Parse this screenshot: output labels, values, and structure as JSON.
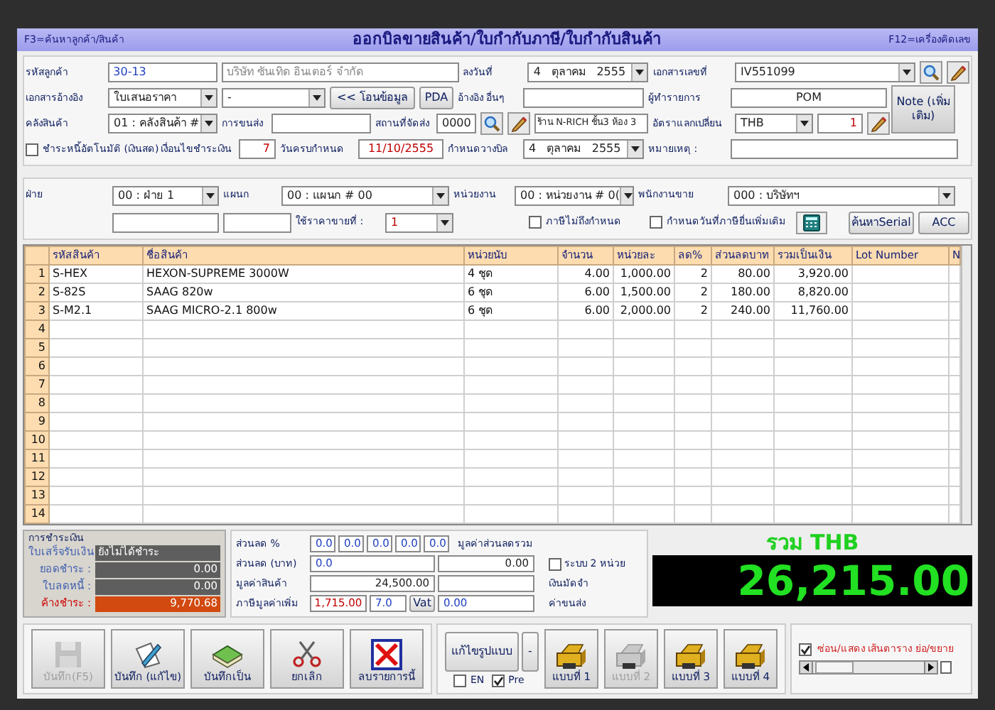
{
  "title_bar": {
    "hotkey_left": "F3=ค้นหาลูกค้า/สินค้า",
    "title": "ออกบิลขายสินค้า/ใบกำกับภาษี/ใบกำกับสินค้า",
    "hotkey_right": "F12=เครื่องคิดเลข"
  },
  "header_rows": [
    [
      {
        "kind": "label",
        "text": "รหัสลูกค้า"
      },
      {
        "kind": "field",
        "value": "30-13"
      },
      {
        "kind": "field",
        "value": "บริษัท ซันเทิด อินเตอร์ จำกัด"
      },
      {
        "kind": "label",
        "text": "ลงวันที่"
      },
      {
        "kind": "select",
        "value": "4   ตุลาคม   2555"
      },
      {
        "kind": "label",
        "text": "เอกสารเลขที่"
      },
      {
        "kind": "select",
        "value": "IV551099"
      },
      {
        "kind": "search"
      },
      {
        "kind": "edit"
      }
    ],
    [
      {
        "kind": "label",
        "text": "เอกสารอ้างอิง"
      },
      {
        "kind": "select",
        "value": "ใบเสนอราคา"
      },
      {
        "kind": "select",
        "value": "-"
      },
      {
        "kind": "button",
        "text": "<< โอนข้อมูล"
      },
      {
        "kind": "button",
        "text": "PDA"
      },
      {
        "kind": "label",
        "text": "อ้างอิง อื่นๆ"
      },
      {
        "kind": "field"
      },
      {
        "kind": "label",
        "text": "ผู้ทำรายการ"
      },
      {
        "kind": "field",
        "value": "POM"
      },
      {
        "kind": "note",
        "text": "Note (เพิ่มเติม)"
      }
    ],
    [
      {
        "kind": "label",
        "text": "คลังสินค้า"
      },
      {
        "kind": "select",
        "value": "01 : คลังสินค้า #"
      },
      {
        "kind": "label",
        "text": "การขนส่ง"
      },
      {
        "kind": "field"
      },
      {
        "kind": "label",
        "text": "สถานที่จัดส่ง"
      },
      {
        "kind": "field",
        "value": "0000"
      },
      {
        "kind": "search"
      },
      {
        "kind": "edit"
      },
      {
        "kind": "field",
        "value": "ร้าน N-RICH ชั้น3 ห้อง 3"
      },
      {
        "kind": "label",
        "text": "อัตราแลกเปลี่ยน"
      },
      {
        "kind": "select",
        "value": "THB"
      },
      {
        "kind": "field",
        "value": "1"
      },
      {
        "kind": "edit"
      }
    ],
    [
      {
        "kind": "checkbox",
        "text": "ชำระหนี้อัตโนมัติ (เงินสด)",
        "checked": false
      },
      {
        "kind": "label",
        "text": "เงื่อนไขชำระเงิน"
      },
      {
        "kind": "field",
        "value": "7"
      },
      {
        "kind": "label",
        "text": "วันครบกำหนด"
      },
      {
        "kind": "field",
        "value": "11/10/2555"
      },
      {
        "kind": "label",
        "text": "กำหนดวางบิล"
      },
      {
        "kind": "select",
        "value": "4   ตุลาคม   2555"
      },
      {
        "kind": "label",
        "text": "หมายเหตุ :"
      },
      {
        "kind": "field"
      }
    ]
  ],
  "filter_rows": [
    [
      {
        "kind": "label",
        "text": "ฝ่าย"
      },
      {
        "kind": "select",
        "value": "00 : ฝ่าย 1"
      },
      {
        "kind": "label",
        "text": "แผนก"
      },
      {
        "kind": "select",
        "value": "00 : แผนก # 00"
      },
      {
        "kind": "label",
        "text": "หน่วยงาน"
      },
      {
        "kind": "select",
        "value": "00 : หน่วยงาน # 0("
      },
      {
        "kind": "label",
        "text": "พนักงานขาย"
      },
      {
        "kind": "select",
        "value": "000 : บริษัทฯ"
      }
    ],
    [
      {
        "kind": "field"
      },
      {
        "kind": "field"
      },
      {
        "kind": "label",
        "text": "ใช้ราคาขายที่ :"
      },
      {
        "kind": "select",
        "value": "1"
      },
      {
        "kind": "checkbox",
        "text": "ภาษีไม่ถึงกำหนด",
        "checked": false
      },
      {
        "kind": "checkbox",
        "text": "กำหนดวันที่ภาษียื่นเพิ่มเติม",
        "checked": false
      },
      {
        "kind": "calc"
      },
      {
        "kind": "button",
        "text": "ค้นหาSerial"
      },
      {
        "kind": "button",
        "text": "ACC"
      }
    ]
  ],
  "table": {
    "columns": [
      "รหัสสินค้า",
      "ชื่อสินค้า",
      "หน่วยนับ",
      "จำนวน",
      "หน่วยละ",
      "ลด%",
      "ส่วนลดบาท",
      "รวมเป็นเงิน",
      "Lot Number",
      "N"
    ],
    "rows": [
      {
        "number": "1",
        "cells": [
          "S-HEX",
          "HEXON-SUPREME 3000W",
          "4 ชุด",
          "4.00",
          "1,000.00",
          "2",
          "80.00",
          "3,920.00"
        ]
      },
      {
        "number": "2",
        "cells": [
          "S-82S",
          "SAAG 820w",
          "6 ชุด",
          "6.00",
          "1,500.00",
          "2",
          "180.00",
          "8,820.00"
        ]
      },
      {
        "number": "3",
        "cells": [
          "S-M2.1",
          "SAAG MICRO-2.1 800w",
          "6 ชุด",
          "6.00",
          "2,000.00",
          "2",
          "240.00",
          "11,760.00"
        ]
      },
      {
        "number": "4"
      },
      {
        "number": "5"
      },
      {
        "number": "6"
      },
      {
        "number": "7"
      },
      {
        "number": "8"
      },
      {
        "number": "9"
      },
      {
        "number": "10"
      },
      {
        "number": "11"
      },
      {
        "number": "12"
      },
      {
        "number": "13"
      },
      {
        "number": "14"
      }
    ]
  },
  "payment": {
    "title": "การชำระเงิน",
    "items": [
      {
        "kind": "status",
        "label": "ใบเสร็จรับเงิน",
        "value": "ยังไม่ได้ชำระ"
      },
      {
        "kind": "amount",
        "label": "ยอดชำระ :",
        "value": "0.00"
      },
      {
        "kind": "amount",
        "label": "ใบลดหนี้ :",
        "value": "0.00"
      },
      {
        "kind": "due",
        "label": "ค้างชำระ :",
        "value": "9,770.68"
      }
    ]
  },
  "summary": {
    "discount_percent": {
      "label": "ส่วนลด %",
      "values": [
        "0.0",
        "0.0",
        "0.0",
        "0.0",
        "0.0"
      ]
    },
    "discount_total": {
      "label": "มูลค่าส่วนลดรวม",
      "value": "0.00"
    },
    "discount_baht": {
      "label": "ส่วนลด (บาท)",
      "value": "0.0"
    },
    "goods_value": {
      "label": "มูลค่าสินค้า",
      "value": "24,500.00"
    },
    "vat": {
      "label": "ภาษีมูลค่าเพิ่ม",
      "amount": "1,715.00",
      "rate": "7.0",
      "button": "Vat",
      "value": "0.00"
    },
    "two_units": {
      "label": "ระบบ 2 หน่วย",
      "checked": false
    },
    "deposit_label": "เงินมัดจำ",
    "shipping_label": "ค่าขนส่ง"
  },
  "total": {
    "label": "รวม THB",
    "value": "26,215.00"
  },
  "actions": [
    {
      "kind": "save",
      "label": "บันทึก(F5)",
      "disabled": true
    },
    {
      "kind": "edit",
      "label": "บันทึก (แก้ไข)",
      "disabled": false
    },
    {
      "kind": "save-as",
      "label": "บันทึกเป็น",
      "disabled": false
    },
    {
      "kind": "cancel",
      "label": "ยกเลิก",
      "disabled": false
    },
    {
      "kind": "delete",
      "label": "ลบรายการนี้",
      "disabled": false
    }
  ],
  "print": {
    "design_button": "แก้ไขรูปแบบ",
    "dash_button": "-",
    "options": [
      {
        "label": "EN",
        "checked": false
      },
      {
        "label": "Pre",
        "checked": true
      }
    ],
    "forms": [
      {
        "label": "แบบที่ 1",
        "disabled": false
      },
      {
        "label": "แบบที่ 2",
        "disabled": true
      },
      {
        "label": "แบบที่ 3",
        "disabled": false
      },
      {
        "label": "แบบที่ 4",
        "disabled": false
      }
    ]
  },
  "grid_toggle": {
    "label": "ซ่อน/แสดง เส้นตาราง ย่อ/ขยาย",
    "checked": true
  }
}
